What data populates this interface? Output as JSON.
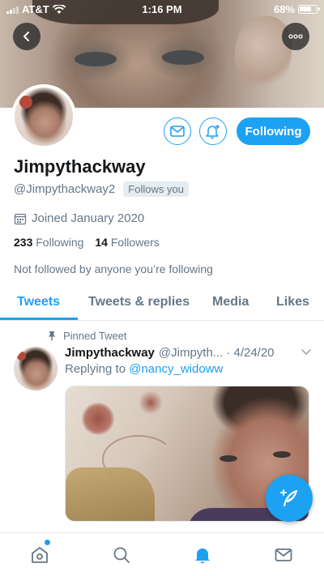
{
  "status_bar": {
    "carrier": "AT&T",
    "time": "1:16 PM",
    "battery": "68%"
  },
  "profile": {
    "name": "Jimpythackway",
    "handle": "@Jimpythackway2",
    "follows_you": "Follows you",
    "joined": "Joined January 2020",
    "following_count": "233",
    "following_label": "Following",
    "followers_count": "14",
    "followers_label": "Followers",
    "not_followed_note": "Not followed by anyone you’re following",
    "following_button": "Following"
  },
  "tabs": [
    {
      "label": "Tweets",
      "active": true
    },
    {
      "label": "Tweets & replies",
      "active": false
    },
    {
      "label": "Media",
      "active": false
    },
    {
      "label": "Likes",
      "active": false
    }
  ],
  "tweet": {
    "pinned_label": "Pinned Tweet",
    "author_name": "Jimpythackway",
    "author_handle": "@Jimpyth...",
    "date": "· 4/24/20",
    "replying_to_prefix": "Replying to",
    "replying_to_handle": "@nancy_widoww"
  },
  "icons": {
    "back": "back-arrow-icon",
    "more": "more-options-icon",
    "mail": "mail-icon",
    "bell": "bell-plus-icon",
    "calendar": "calendar-icon",
    "pin": "pin-icon",
    "chevron": "chevron-down-icon",
    "compose": "compose-feather-icon",
    "nav": [
      "home-icon",
      "search-icon",
      "notifications-bell-icon",
      "messages-mail-icon"
    ]
  },
  "colors": {
    "accent": "#1da1f2",
    "secondary_text": "#657786",
    "primary_text": "#14171a"
  }
}
